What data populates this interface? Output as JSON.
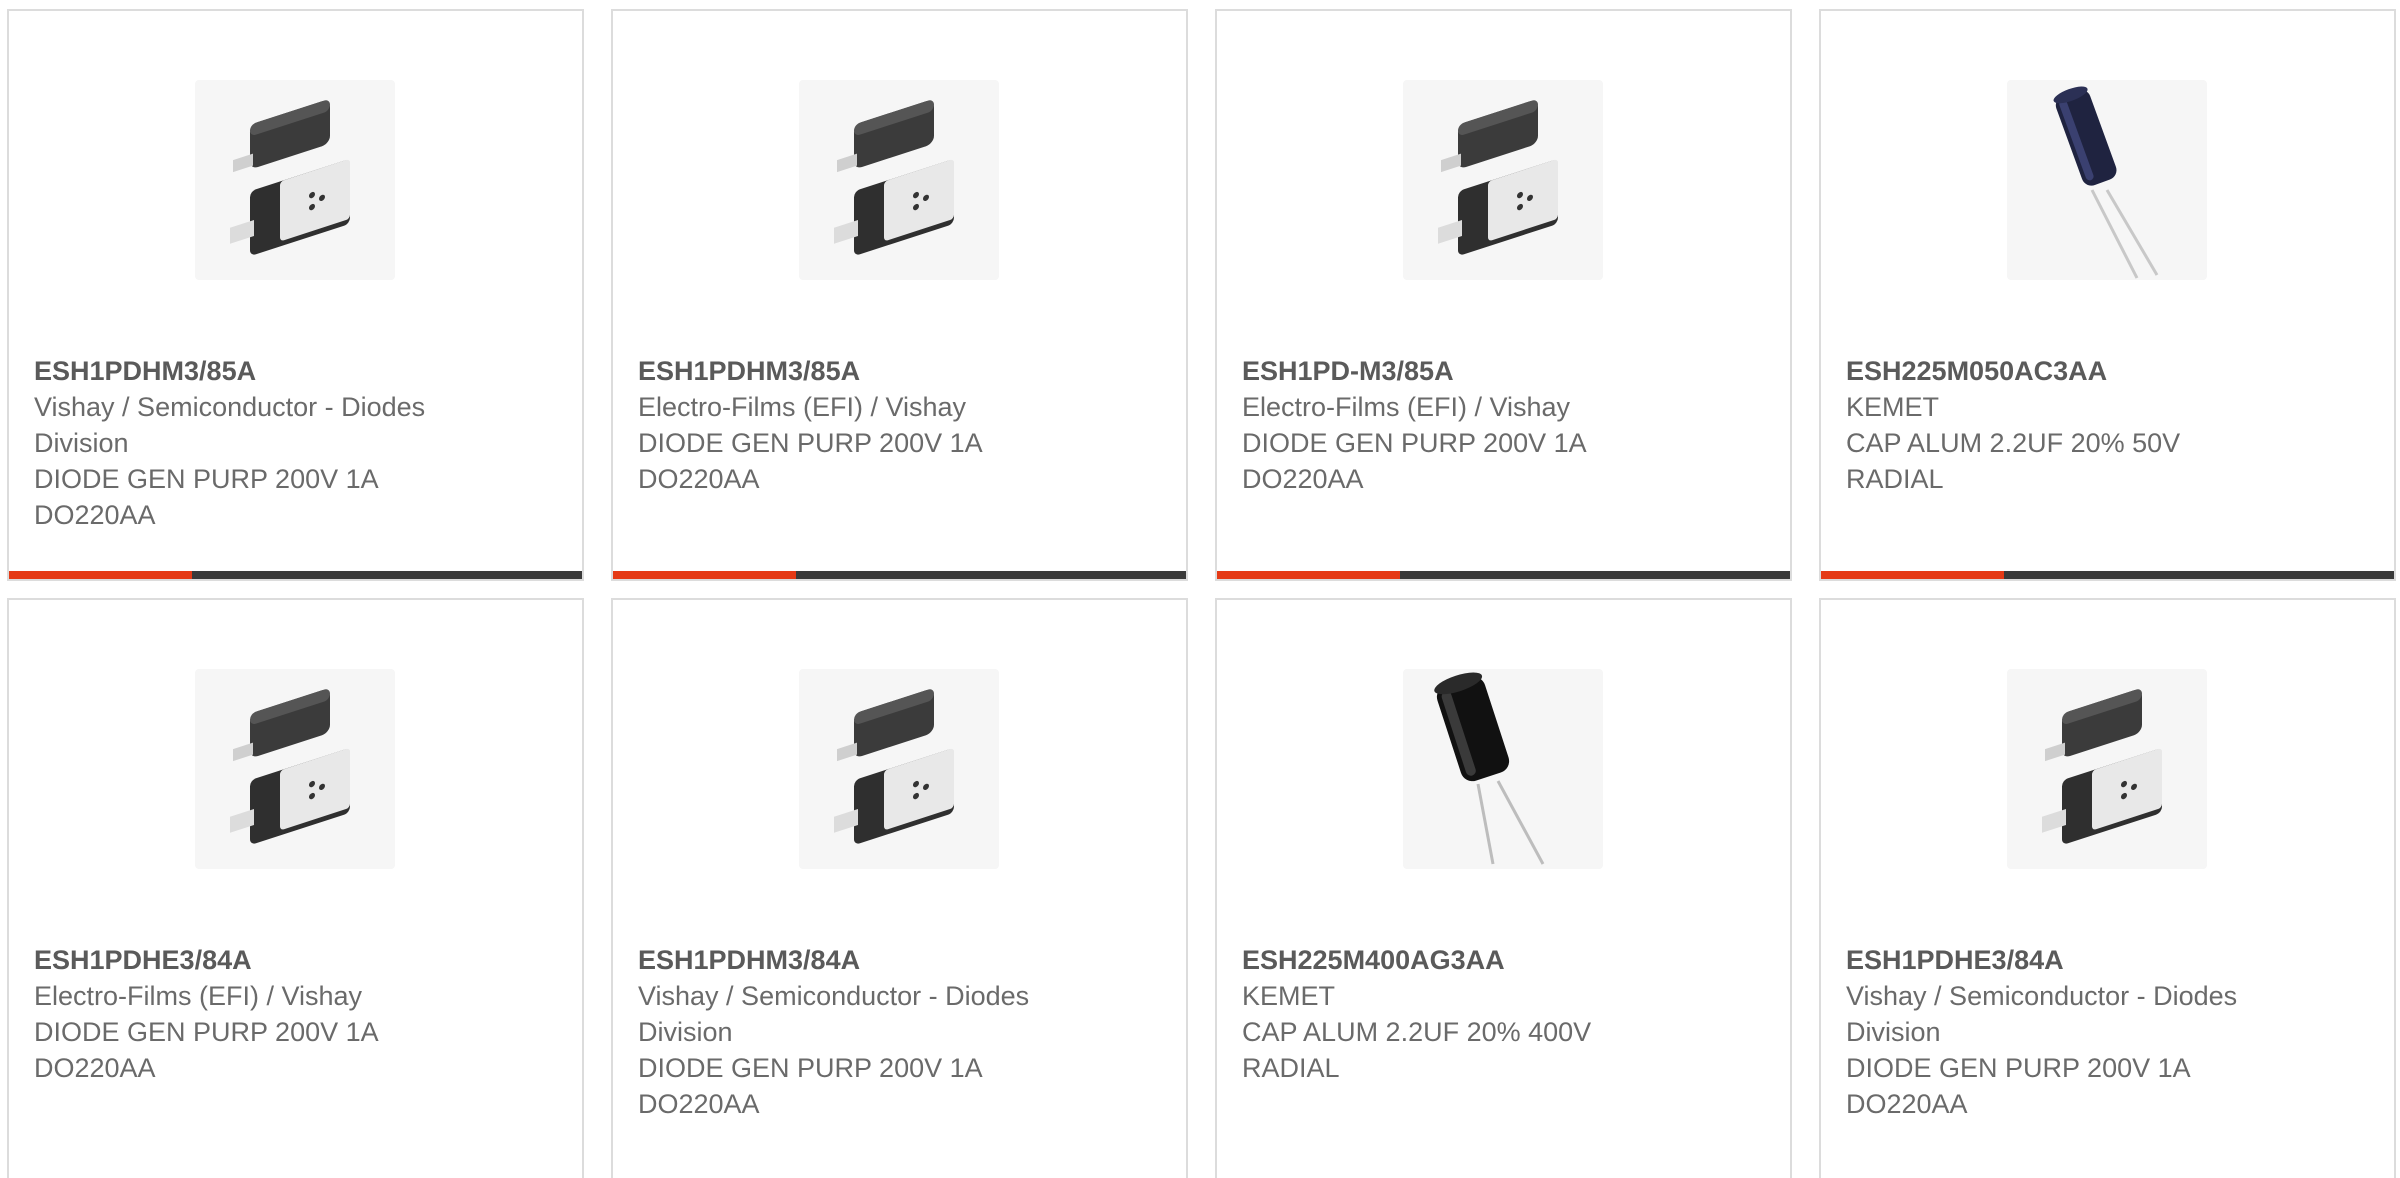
{
  "products": [
    {
      "part_number": "ESH1PDHM3/85A",
      "manufacturer": "Vishay / Semiconductor - Diodes Division",
      "manufacturer_lines": [
        "Vishay / Semiconductor - Diodes",
        "Division"
      ],
      "description_lines": [
        "DIODE GEN PURP 200V 1A",
        "DO220AA"
      ],
      "image": "diode-smd-package-image",
      "progress": 0.32
    },
    {
      "part_number": "ESH1PDHM3/85A",
      "manufacturer": "Electro-Films (EFI) / Vishay",
      "manufacturer_lines": [
        "Electro-Films (EFI) / Vishay"
      ],
      "description_lines": [
        "DIODE GEN PURP 200V 1A",
        "DO220AA"
      ],
      "image": "diode-smd-package-image",
      "progress": 0.32
    },
    {
      "part_number": "ESH1PD-M3/85A",
      "manufacturer": "Electro-Films (EFI) / Vishay",
      "manufacturer_lines": [
        "Electro-Films (EFI) / Vishay"
      ],
      "description_lines": [
        "DIODE GEN PURP 200V 1A",
        "DO220AA"
      ],
      "image": "diode-smd-package-image",
      "progress": 0.32
    },
    {
      "part_number": "ESH225M050AC3AA",
      "manufacturer": "KEMET",
      "manufacturer_lines": [
        "KEMET"
      ],
      "description_lines": [
        "CAP ALUM 2.2UF 20% 50V",
        "RADIAL"
      ],
      "image": "radial-capacitor-image",
      "progress": 0.32
    },
    {
      "part_number": "ESH1PDHE3/84A",
      "manufacturer": "Electro-Films (EFI) / Vishay",
      "manufacturer_lines": [
        "Electro-Films (EFI) / Vishay"
      ],
      "description_lines": [
        "DIODE GEN PURP 200V 1A",
        "DO220AA"
      ],
      "image": "diode-smd-package-image"
    },
    {
      "part_number": "ESH1PDHM3/84A",
      "manufacturer": "Vishay / Semiconductor - Diodes Division",
      "manufacturer_lines": [
        "Vishay / Semiconductor - Diodes",
        "Division"
      ],
      "description_lines": [
        "DIODE GEN PURP 200V 1A",
        "DO220AA"
      ],
      "image": "diode-smd-package-image"
    },
    {
      "part_number": "ESH225M400AG3AA",
      "manufacturer": "KEMET",
      "manufacturer_lines": [
        "KEMET"
      ],
      "description_lines": [
        "CAP ALUM 2.2UF 20% 400V",
        "RADIAL"
      ],
      "image": "radial-capacitor-black-image"
    },
    {
      "part_number": "ESH1PDHE3/84A",
      "manufacturer": "Vishay / Semiconductor - Diodes Division",
      "manufacturer_lines": [
        "Vishay / Semiconductor - Diodes",
        "Division"
      ],
      "description_lines": [
        "DIODE GEN PURP 200V 1A",
        "DO220AA"
      ],
      "image": "diode-smd-package-image"
    }
  ],
  "colors": {
    "progress_fill": "#e53a16",
    "progress_track": "#3a3a3a",
    "card_border": "#dcdcdc",
    "text": "#6a6a6a"
  }
}
